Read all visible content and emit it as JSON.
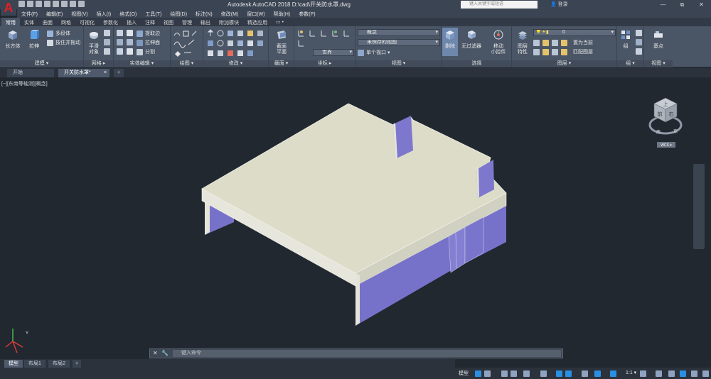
{
  "app": {
    "logo": "A",
    "title": "Autodesk AutoCAD 2018    D:\\cad\\开关防水罩.dwg",
    "search_placeholder": "键入关键字或短语",
    "login": "登录",
    "window_controls": [
      "—",
      "⧉",
      "✕"
    ]
  },
  "menu": [
    "文件(F)",
    "编辑(E)",
    "视图(V)",
    "插入(I)",
    "格式(O)",
    "工具(T)",
    "绘图(D)",
    "标注(N)",
    "修改(M)",
    "窗口(W)",
    "帮助(H)",
    "参数(P)"
  ],
  "ribbon_tabs": [
    "常用",
    "实体",
    "曲面",
    "网格",
    "可视化",
    "参数化",
    "插入",
    "注释",
    "视图",
    "管理",
    "输出",
    "附加模块",
    "精选应用",
    "▭ •"
  ],
  "ribbon": {
    "modeling": {
      "title": "建模 ▾",
      "box": "长方体",
      "extrude": "拉伸",
      "polysolid": "多段体",
      "presspull": "按住并拖动"
    },
    "mesh": {
      "title": "网格 ▸",
      "smooth_object": "平滑\n对象"
    },
    "solid_edit": {
      "title": "实体编辑 ▾",
      "extract_edges": "提取边",
      "extrude_faces": "拉伸面",
      "separate": "分割"
    },
    "draw": {
      "title": "绘图 ▾"
    },
    "modify": {
      "title": "修改 ▾"
    },
    "section": {
      "title": "截面 ▾",
      "section_plane": "截面\n平面"
    },
    "coordinates": {
      "title": "坐标 ▸",
      "world": "世界"
    },
    "view": {
      "title": "视图 ▾",
      "visual_style": "概念",
      "unsaved_view": "未保存的视图",
      "single_viewport": "单个视口 ▾"
    },
    "selection": {
      "title": "选择",
      "culling": "剔除",
      "no_filter": "无过滤器",
      "move_gizmo": "移动\n小控件"
    },
    "layers": {
      "title": "图层 ▾",
      "layer_properties": "图层\n特性",
      "current_layer": "0",
      "set_current": "置为当前",
      "match_layer": "匹配图层"
    },
    "groups": {
      "title": "组 ▾",
      "group": "组"
    },
    "view2": {
      "title": "视图 ▾",
      "base": "基点"
    }
  },
  "file_tabs": {
    "start": "开始",
    "document": "开关防水罩*",
    "plus": "+"
  },
  "viewport": {
    "label": "[−][东南等轴测][概念]",
    "viewcube": {
      "top": "上",
      "front": "前",
      "right": "右",
      "south": "南",
      "east": "东",
      "wcs": "WCS ▾"
    }
  },
  "command": {
    "placeholder": "键入命令"
  },
  "layout_tabs": [
    "模型",
    "布局1",
    "布局2",
    "+"
  ],
  "status": {
    "model": "模型",
    "scale": "1:1 ▾"
  },
  "colors": {
    "background": "#212830",
    "slab_top": "#dcdcc9",
    "wall_face": "#7772c9",
    "wall_face_light": "#8682d6",
    "edge": "#e8e8df",
    "autocad_red": "#e21f26"
  }
}
